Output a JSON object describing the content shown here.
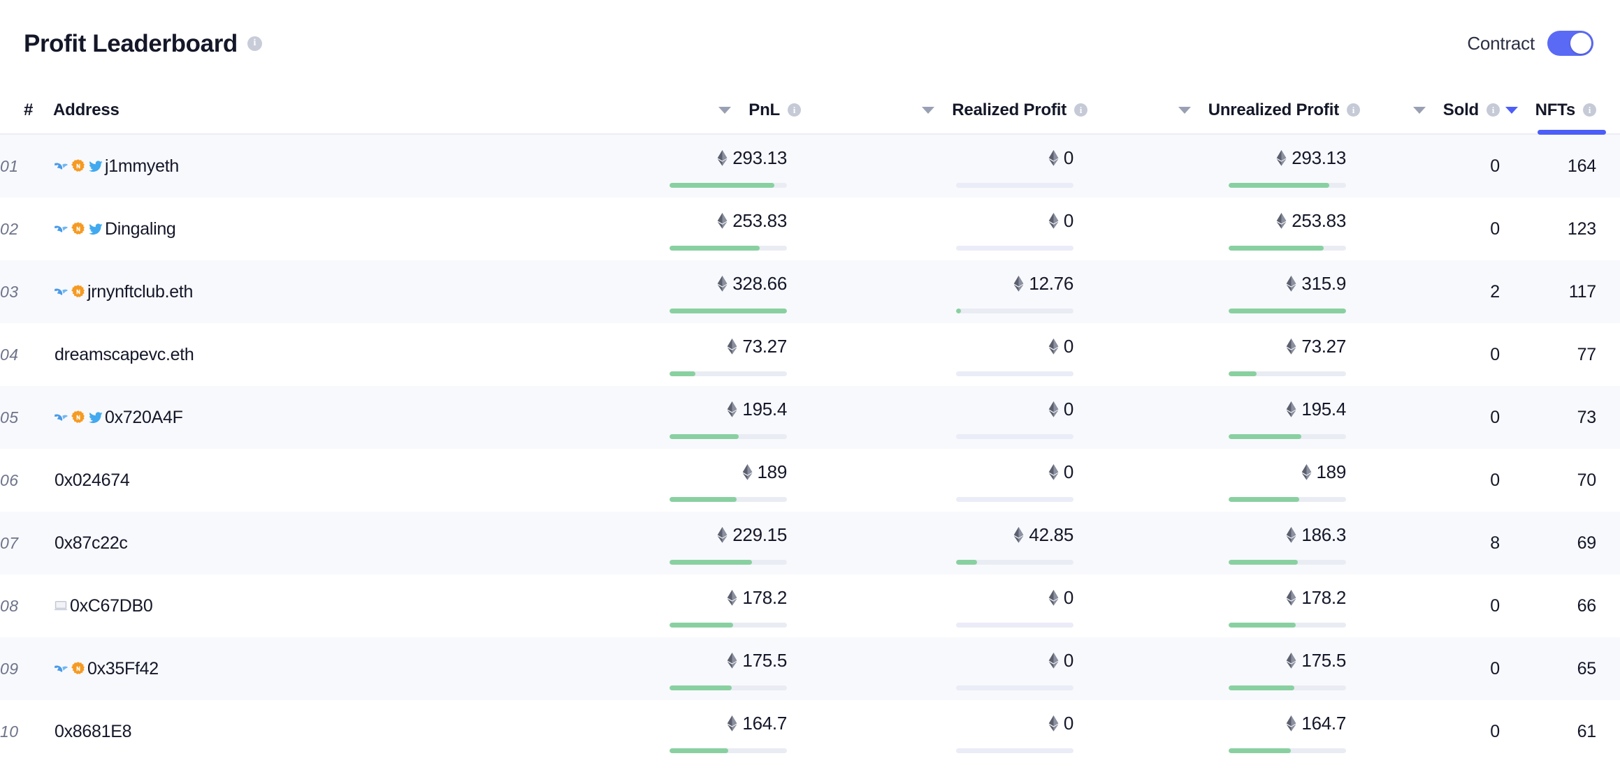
{
  "header": {
    "title": "Profit Leaderboard",
    "title_info_icon": "info-icon",
    "toggle_label": "Contract",
    "toggle_state": "on",
    "accent_color": "#5b6af5"
  },
  "table": {
    "columns": [
      {
        "key": "rank",
        "label": "#",
        "align": "left",
        "sortable": false,
        "has_info": false,
        "sort_active": false
      },
      {
        "key": "address",
        "label": "Address",
        "align": "left",
        "sortable": false,
        "has_info": false,
        "sort_active": false
      },
      {
        "key": "pnl",
        "label": "PnL",
        "align": "right",
        "sortable": true,
        "has_info": true,
        "sort_active": false
      },
      {
        "key": "realized",
        "label": "Realized Profit",
        "align": "right",
        "sortable": true,
        "has_info": true,
        "sort_active": false
      },
      {
        "key": "unrealized",
        "label": "Unrealized Profit",
        "align": "right",
        "sortable": true,
        "has_info": true,
        "sort_active": false
      },
      {
        "key": "sold",
        "label": "Sold",
        "align": "right",
        "sortable": true,
        "has_info": true,
        "sort_active": false
      },
      {
        "key": "nfts",
        "label": "NFTs",
        "align": "right",
        "sortable": true,
        "has_info": true,
        "sort_active": true
      }
    ],
    "rows": [
      {
        "rank": "01",
        "address": "j1mmyeth",
        "badges": [
          "dolphin-icon",
          "nft-hex-icon",
          "twitter-icon"
        ],
        "pnl": "293.13",
        "pnl_bar": 89,
        "realized": "0",
        "realized_bar": 0,
        "unrealized": "293.13",
        "unrealized_bar": 86,
        "sold": "0",
        "nfts": "164"
      },
      {
        "rank": "02",
        "address": "Dingaling",
        "badges": [
          "dolphin-icon",
          "nft-hex-icon",
          "twitter-icon"
        ],
        "pnl": "253.83",
        "pnl_bar": 77,
        "realized": "0",
        "realized_bar": 0,
        "unrealized": "253.83",
        "unrealized_bar": 81,
        "sold": "0",
        "nfts": "123"
      },
      {
        "rank": "03",
        "address": "jrnynftclub.eth",
        "badges": [
          "dolphin-icon",
          "nft-hex-icon"
        ],
        "pnl": "328.66",
        "pnl_bar": 100,
        "realized": "12.76",
        "realized_bar": 4,
        "unrealized": "315.9",
        "unrealized_bar": 100,
        "sold": "2",
        "nfts": "117"
      },
      {
        "rank": "04",
        "address": "dreamscapevc.eth",
        "badges": [],
        "pnl": "73.27",
        "pnl_bar": 22,
        "realized": "0",
        "realized_bar": 0,
        "unrealized": "73.27",
        "unrealized_bar": 24,
        "sold": "0",
        "nfts": "77"
      },
      {
        "rank": "05",
        "address": "0x720A4F",
        "badges": [
          "dolphin-icon",
          "nft-hex-icon",
          "twitter-icon"
        ],
        "pnl": "195.4",
        "pnl_bar": 59,
        "realized": "0",
        "realized_bar": 0,
        "unrealized": "195.4",
        "unrealized_bar": 62,
        "sold": "0",
        "nfts": "73"
      },
      {
        "rank": "06",
        "address": "0x024674",
        "badges": [],
        "pnl": "189",
        "pnl_bar": 57,
        "realized": "0",
        "realized_bar": 0,
        "unrealized": "189",
        "unrealized_bar": 60,
        "sold": "0",
        "nfts": "70"
      },
      {
        "rank": "07",
        "address": "0x87c22c",
        "badges": [],
        "pnl": "229.15",
        "pnl_bar": 70,
        "realized": "42.85",
        "realized_bar": 18,
        "unrealized": "186.3",
        "unrealized_bar": 59,
        "sold": "8",
        "nfts": "69"
      },
      {
        "rank": "08",
        "address": "0xC67DB0",
        "badges": [
          "laptop-icon"
        ],
        "pnl": "178.2",
        "pnl_bar": 54,
        "realized": "0",
        "realized_bar": 0,
        "unrealized": "178.2",
        "unrealized_bar": 57,
        "sold": "0",
        "nfts": "66"
      },
      {
        "rank": "09",
        "address": "0x35Ff42",
        "badges": [
          "dolphin-icon",
          "nft-hex-icon"
        ],
        "pnl": "175.5",
        "pnl_bar": 53,
        "realized": "0",
        "realized_bar": 0,
        "unrealized": "175.5",
        "unrealized_bar": 56,
        "sold": "0",
        "nfts": "65"
      },
      {
        "rank": "10",
        "address": "0x8681E8",
        "badges": [],
        "pnl": "164.7",
        "pnl_bar": 50,
        "realized": "0",
        "realized_bar": 0,
        "unrealized": "164.7",
        "unrealized_bar": 53,
        "sold": "0",
        "nfts": "61"
      }
    ]
  }
}
